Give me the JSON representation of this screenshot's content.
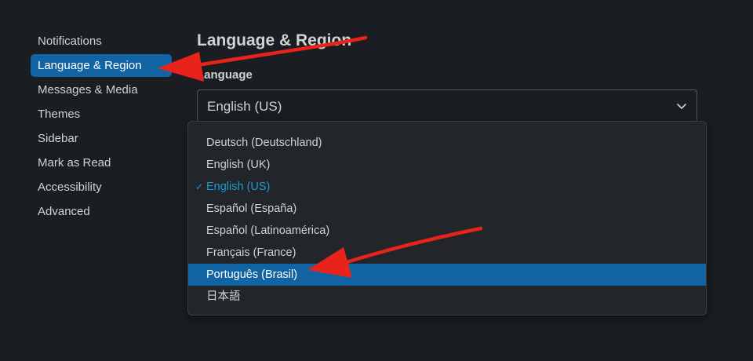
{
  "sidebar": {
    "items": [
      {
        "label": "Notifications"
      },
      {
        "label": "Language & Region"
      },
      {
        "label": "Messages & Media"
      },
      {
        "label": "Themes"
      },
      {
        "label": "Sidebar"
      },
      {
        "label": "Mark as Read"
      },
      {
        "label": "Accessibility"
      },
      {
        "label": "Advanced"
      }
    ],
    "active_index": 1
  },
  "main": {
    "title": "Language & Region",
    "language_label": "Language",
    "select_value": "English (US)",
    "chevron_icon": "chevron-down-icon"
  },
  "dropdown": {
    "options": [
      {
        "label": "Deutsch (Deutschland)"
      },
      {
        "label": "English (UK)"
      },
      {
        "label": "English (US)"
      },
      {
        "label": "Español (España)"
      },
      {
        "label": "Español (Latinoamérica)"
      },
      {
        "label": "Français (France)"
      },
      {
        "label": "Português (Brasil)"
      },
      {
        "label": "日本語"
      }
    ],
    "selected_option": "English (US)",
    "highlighted_option": "Português (Brasil)",
    "check_icon": "✓"
  },
  "colors": {
    "background": "#1a1d21",
    "accent": "#1164a3",
    "selected_text": "#1d9bd1",
    "annotation_arrow": "#e8231c"
  }
}
